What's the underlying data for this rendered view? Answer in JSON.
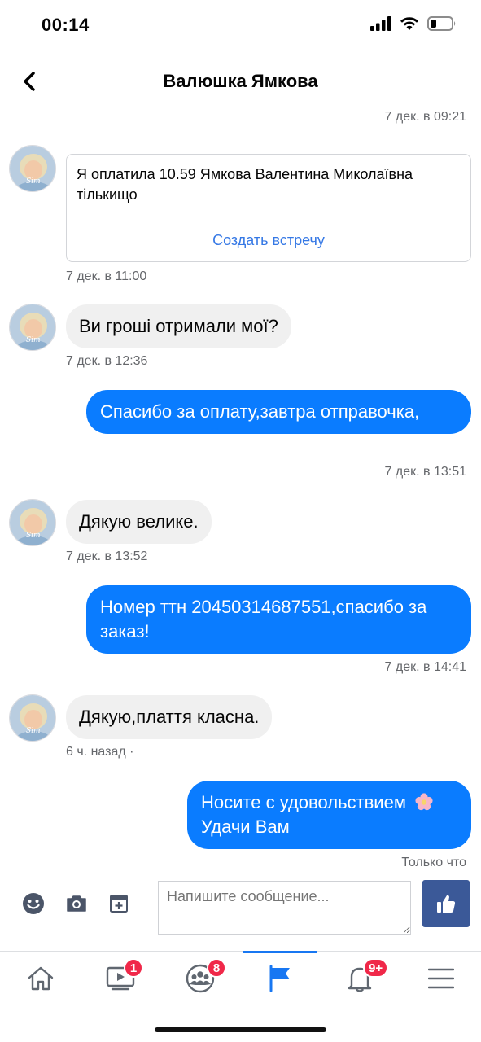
{
  "status": {
    "time": "00:14"
  },
  "header": {
    "title": "Валюшка Ямкова"
  },
  "card": {
    "text": "Я оплатила 10.59 Ямкова Валентина Миколаївна тількищо",
    "action": "Создать встречу"
  },
  "timestamps": {
    "t0": "7 дек. в 09:21",
    "t1": "7 дек. в 11:00",
    "t2": "7 дек. в 12:36",
    "t3": "7 дек. в 13:51",
    "t4": "7 дек. в 13:52",
    "t5": "7 дек. в 14:41",
    "t6": "6 ч. назад ·",
    "t7": "Только что"
  },
  "messages": {
    "m1": "Ви гроші отримали мої?",
    "m2": "Спасибо за оплату,завтра отправочка,",
    "m3": "Дякую велике.",
    "m4": "Номер ттн 20450314687551,спасибо за заказ!",
    "m5": "Дякую,плаття класна.",
    "m6_line1": "Носите с удовольствием",
    "m6_line2": "Удачи Вам"
  },
  "composer": {
    "placeholder": "Напишите сообщение..."
  },
  "tabs": {
    "video_badge": "1",
    "groups_badge": "8",
    "notifications_badge": "9+"
  },
  "colors": {
    "outgoing": "#0a7cff",
    "incoming": "#f0f0f0",
    "like": "#3b5998",
    "badge": "#f02849"
  }
}
